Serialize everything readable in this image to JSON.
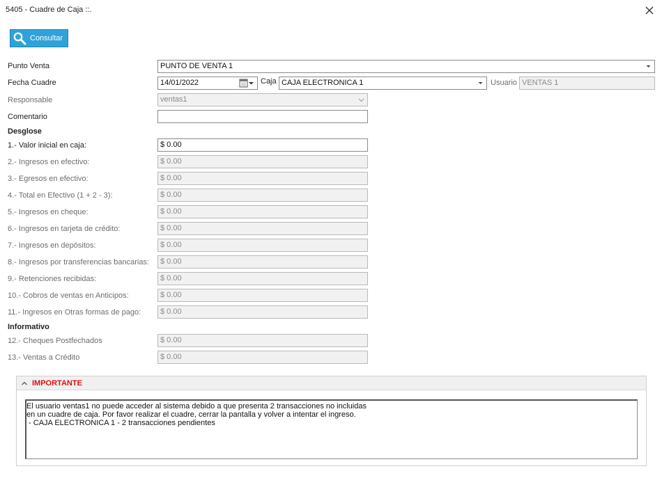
{
  "window": {
    "title": "5405 - Cuadre de Caja ::."
  },
  "toolbar": {
    "consultar_label": "Consultar"
  },
  "form": {
    "punto_venta": {
      "label": "Punto Venta",
      "value": "PUNTO DE VENTA 1"
    },
    "fecha_cuadre": {
      "label": "Fecha Cuadre",
      "value": "14/01/2022"
    },
    "caja": {
      "label": "Caja",
      "value": "CAJA ELECTRONICA 1"
    },
    "usuario": {
      "label": "Usuario",
      "value": "VENTAS 1"
    },
    "responsable": {
      "label": "Responsable",
      "value": "ventas1"
    },
    "comentario": {
      "label": "Comentario",
      "value": ""
    }
  },
  "desglose": {
    "title": "Desglose",
    "items": [
      {
        "label": "1.- Valor inicial en caja:",
        "value": "$ 0.00"
      },
      {
        "label": "2.- Ingresos en efectivo:",
        "value": "$ 0.00"
      },
      {
        "label": "3.- Egresos en efectivo:",
        "value": "$ 0.00"
      },
      {
        "label": "4.- Total en Efectivo (1 + 2 - 3):",
        "value": "$ 0.00"
      },
      {
        "label": "5.- Ingresos en cheque:",
        "value": "$ 0.00"
      },
      {
        "label": "6.- Ingresos en tarjeta de crédito:",
        "value": "$ 0.00"
      },
      {
        "label": "7.- Ingresos en depósitos:",
        "value": "$ 0.00"
      },
      {
        "label": "8.- Ingresos por transferencias bancarias:",
        "value": "$ 0.00"
      },
      {
        "label": "9.- Retenciones recibidas:",
        "value": "$ 0.00"
      },
      {
        "label": "10.- Cobros de ventas en Anticipos:",
        "value": "$ 0.00"
      },
      {
        "label": "11.- Ingresos en Otras formas de pago:",
        "value": "$ 0.00"
      }
    ]
  },
  "informativo": {
    "title": "Informativo",
    "items": [
      {
        "label": "12.- Cheques Postfechados",
        "value": "$ 0.00"
      },
      {
        "label": "13.- Ventas a Crédito",
        "value": "$ 0.00"
      }
    ]
  },
  "importante": {
    "title": "IMPORTANTE",
    "lines": [
      "El usuario ventas1 no puede acceder al sistema debido a que presenta 2 transacciones no incluidas",
      "en un cuadre de caja. Por favor realizar el cuadre, cerrar la pantalla y volver a intentar el ingreso.",
      " - CAJA ELECTRONICA 1 - 2 transacciones pendientes"
    ]
  },
  "colors": {
    "accent": "#2fa3d9",
    "warning": "#e01010"
  }
}
